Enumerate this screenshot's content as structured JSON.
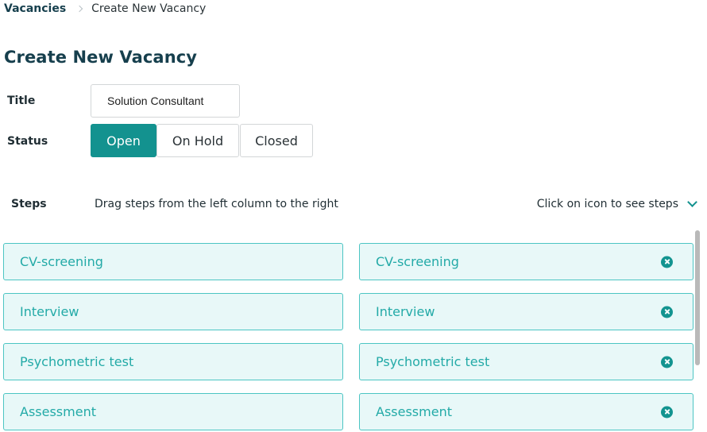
{
  "breadcrumb": {
    "root": "Vacancies",
    "current": "Create New Vacancy"
  },
  "page": {
    "title": "Create New Vacancy"
  },
  "form": {
    "title_label": "Title",
    "title_value": "Solution Consultant",
    "status_label": "Status",
    "status_options": [
      "Open",
      "On Hold",
      "Closed"
    ],
    "status_selected": "Open"
  },
  "steps": {
    "label": "Steps",
    "hint": "Drag steps from the left column to the right",
    "toggle_label": "Click on icon to see steps",
    "available": [
      "CV-screening",
      "Interview",
      "Psychometric test",
      "Assessment"
    ],
    "selected": [
      "CV-screening",
      "Interview",
      "Psychometric test",
      "Assessment"
    ]
  },
  "colors": {
    "accent": "#13928f",
    "card_bg": "#e8f8f8",
    "card_border": "#4cc5c3",
    "card_text": "#23aaa7",
    "heading": "#163f4d"
  },
  "icons": {
    "breadcrumb_separator": "chevron-right-icon",
    "steps_toggle": "chevron-down-icon",
    "remove_step": "close-circle-icon"
  }
}
